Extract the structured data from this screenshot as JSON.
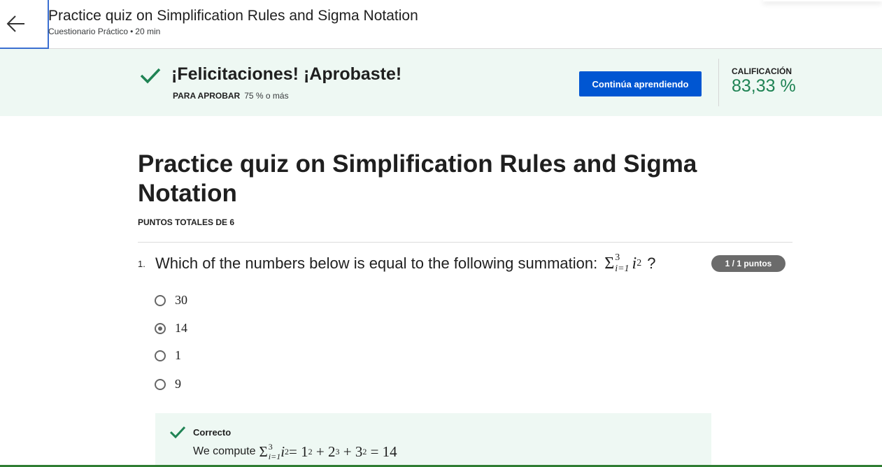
{
  "header": {
    "back_icon": "arrow-left-icon",
    "title": "Practice quiz on Simplification Rules and Sigma Notation",
    "subtitle_type": "Cuestionario Práctico",
    "subtitle_sep": "•",
    "subtitle_duration": "20 min"
  },
  "banner": {
    "check_icon": "check-icon",
    "message": "¡Felicitaciones! ¡Aprobaste!",
    "pass_label": "PARA APROBAR",
    "pass_value": "75 % o más",
    "continue_label": "Continúa aprendiendo",
    "grade_label": "CALIFICACIÓN",
    "grade_value": "83,33 %",
    "accent_color": "#1f8354",
    "button_color": "#0056d2"
  },
  "quiz": {
    "title": "Practice quiz on Simplification Rules and Sigma Notation",
    "total_points": "PUNTOS TOTALES DE 6",
    "questions": [
      {
        "number": "1.",
        "text": "Which of the numbers below is equal to the following summation:",
        "math": {
          "sigma": "Σ",
          "upper": "3",
          "lower": "i=1",
          "var": "i",
          "exp": "2",
          "qmark": "?"
        },
        "points": "1 / 1 puntos",
        "options": [
          {
            "label": "30",
            "selected": false
          },
          {
            "label": "14",
            "selected": true
          },
          {
            "label": "1",
            "selected": false
          },
          {
            "label": "9",
            "selected": false
          }
        ],
        "feedback": {
          "title": "Correcto",
          "text": "We compute",
          "math": {
            "sigma": "Σ",
            "upper": "3",
            "lower": "i=1",
            "var": "i",
            "exp": "2",
            "rhs": "= 1",
            "rhs_exp1": "2",
            "plus1": " + 2",
            "rhs_exp2": "3",
            "plus2": " + 3",
            "rhs_exp3": "2",
            "result": " = 14"
          }
        }
      }
    ]
  }
}
